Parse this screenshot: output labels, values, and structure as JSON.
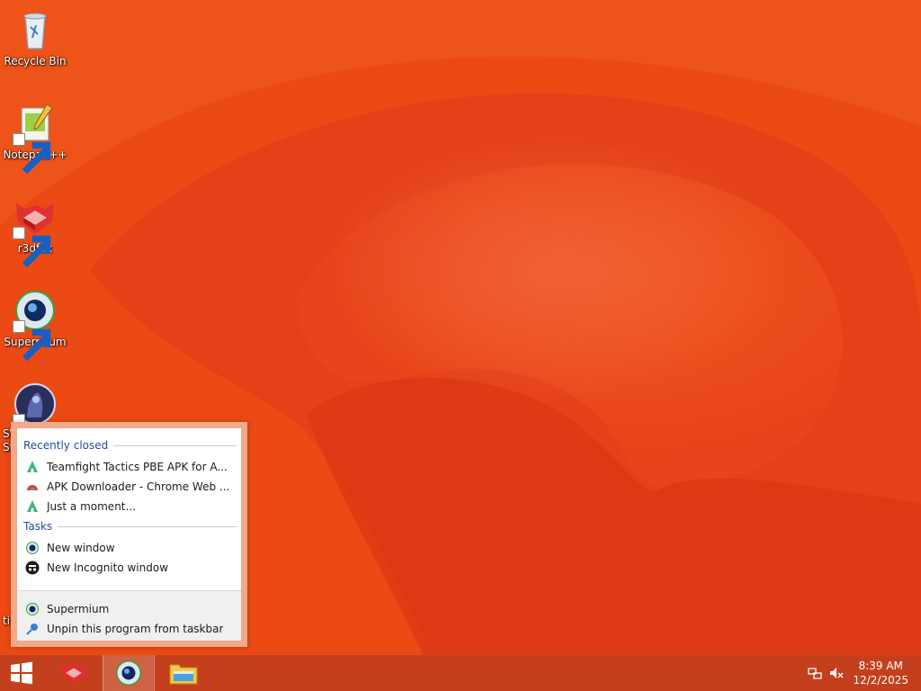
{
  "desktop": {
    "icons": [
      {
        "label": "Recycle Bin",
        "icon": "recycle-bin-icon"
      },
      {
        "label": "Notepad++",
        "icon": "notepadpp-icon"
      },
      {
        "label": "r3dfox",
        "icon": "r3dfox-icon"
      },
      {
        "label": "Supermium",
        "icon": "supermium-icon"
      },
      {
        "label": "",
        "icon": "game-shortcut-icon"
      }
    ],
    "partial_labels": [
      "SV",
      "St",
      "ti"
    ]
  },
  "jumplist": {
    "recently_closed_header": "Recently closed",
    "recent": [
      {
        "label": "Teamfight Tactics PBE APK for A...",
        "icon": "apk-logo-icon"
      },
      {
        "label": "APK Downloader - Chrome Web ...",
        "icon": "apk-downloader-icon"
      },
      {
        "label": "Just a moment...",
        "icon": "apk-logo-icon"
      }
    ],
    "tasks_header": "Tasks",
    "tasks": [
      {
        "label": "New window",
        "icon": "supermium-icon"
      },
      {
        "label": "New Incognito window",
        "icon": "incognito-icon"
      }
    ],
    "footer": [
      {
        "label": "Supermium",
        "icon": "supermium-icon"
      },
      {
        "label": "Unpin this program from taskbar",
        "icon": "unpin-icon"
      }
    ]
  },
  "taskbar": {
    "buttons": [
      "start-button",
      "r3dfox",
      "supermium",
      "file-explorer"
    ],
    "clock": {
      "time": "8:39 AM",
      "date": "12/2/2025"
    }
  },
  "colors": {
    "wallpaper_base": "#e9420f",
    "taskbar": "#c4401c",
    "jumplist_frame": "#f2a98a",
    "header_text": "#1e4e9c"
  }
}
